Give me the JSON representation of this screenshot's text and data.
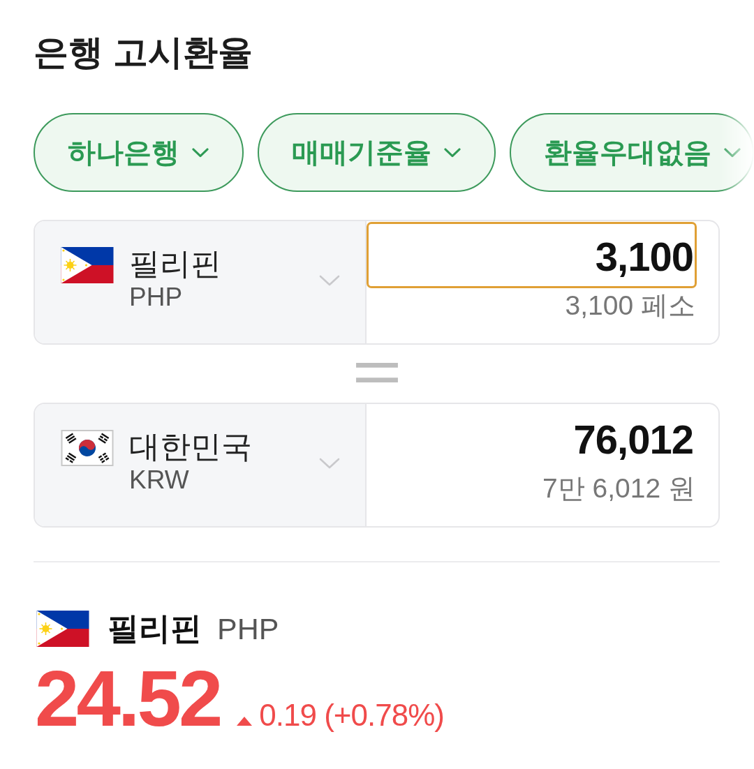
{
  "title": "은행 고시환율",
  "filters": [
    {
      "label": "하나은행"
    },
    {
      "label": "매매기준율"
    },
    {
      "label": "환율우대없음"
    }
  ],
  "converter": {
    "rows": [
      {
        "country": "필리핀",
        "code": "PHP",
        "amount": "3,100",
        "amount_in_words": "3,100 페소",
        "focused": true
      },
      {
        "country": "대한민국",
        "code": "KRW",
        "amount": "76,012",
        "amount_in_words": "7만 6,012 원",
        "focused": false
      }
    ]
  },
  "rate": {
    "country": "필리핀",
    "code": "PHP",
    "value": "24.52",
    "rising": true,
    "change": "0.19 (+0.78%)"
  }
}
